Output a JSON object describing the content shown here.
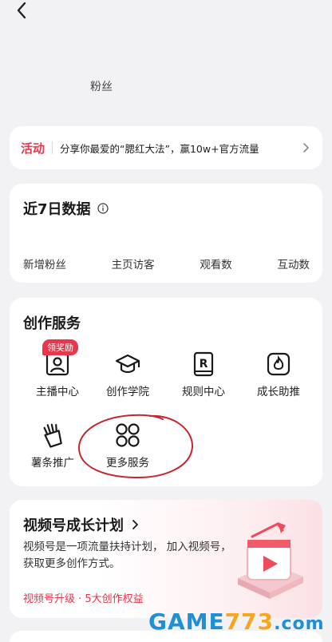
{
  "header": {
    "back_icon": "chevron-left-icon"
  },
  "profile": {
    "fans_label": "粉丝"
  },
  "activity": {
    "tag": "活动",
    "text": "分享你最爱的“腮红大法”，赢10w+官方流量",
    "accent": "#e8364b"
  },
  "stats": {
    "title": "近7日数据",
    "labels": [
      "新增粉丝",
      "主页访客",
      "观看数",
      "互动数"
    ]
  },
  "services": {
    "title": "创作服务",
    "badge": "领奖励",
    "items": [
      {
        "label": "主播中心",
        "icon": "anchor-center-icon"
      },
      {
        "label": "创作学院",
        "icon": "graduation-cap-icon"
      },
      {
        "label": "规则中心",
        "icon": "rules-book-icon"
      },
      {
        "label": "成长助推",
        "icon": "flame-icon"
      },
      {
        "label": "薯条推广",
        "icon": "fries-icon"
      },
      {
        "label": "更多服务",
        "icon": "four-circles-icon"
      }
    ]
  },
  "growth": {
    "title": "视频号成长计划",
    "desc": "视频号是一项流量扶持计划， 加入视频号，获取更多创作方式。",
    "link": "视频号升级 · 5大创作权益"
  },
  "watermark": {
    "brand": "GAME",
    "number": "773",
    "domain": ".com"
  }
}
